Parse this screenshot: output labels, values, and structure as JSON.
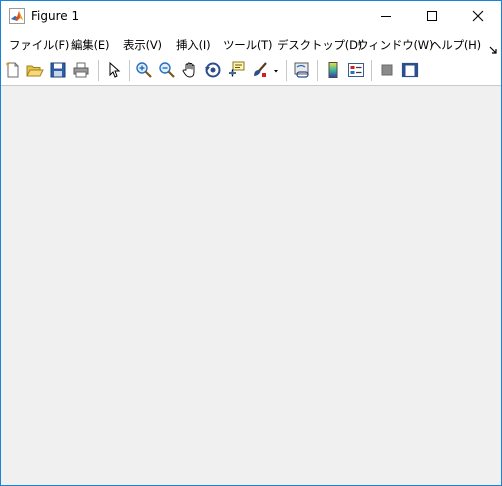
{
  "window": {
    "title": "Figure 1",
    "accent_color": "#1883d7",
    "figure_background": "#f0f0f0"
  },
  "titlebar": {
    "app_icon": "matlab-icon",
    "minimize_icon": "minimize-icon",
    "maximize_icon": "maximize-icon",
    "close_icon": "close-icon"
  },
  "menubar": {
    "items": [
      {
        "label": "ファイル(F)"
      },
      {
        "label": "編集(E)"
      },
      {
        "label": "表示(V)"
      },
      {
        "label": "挿入(I)"
      },
      {
        "label": "ツール(T)"
      },
      {
        "label": "デスクトップ(D)"
      },
      {
        "label": "ウィンドウ(W)"
      },
      {
        "label": "ヘルプ(H)"
      }
    ],
    "overflow_icon": "menu-overflow-arrow-icon"
  },
  "toolbar": {
    "buttons": [
      {
        "icon": "new-figure-icon"
      },
      {
        "icon": "open-file-icon"
      },
      {
        "icon": "save-icon"
      },
      {
        "icon": "print-icon"
      },
      {
        "icon": "edit-plot-arrow-icon"
      },
      {
        "icon": "zoom-in-icon"
      },
      {
        "icon": "zoom-out-icon"
      },
      {
        "icon": "pan-hand-icon"
      },
      {
        "icon": "rotate-3d-icon"
      },
      {
        "icon": "data-cursor-icon"
      },
      {
        "icon": "brush-icon"
      },
      {
        "icon": "link-plot-icon"
      },
      {
        "icon": "insert-colorbar-icon"
      },
      {
        "icon": "insert-legend-icon"
      },
      {
        "icon": "hide-plot-tools-icon"
      },
      {
        "icon": "show-plot-tools-icon"
      }
    ]
  }
}
